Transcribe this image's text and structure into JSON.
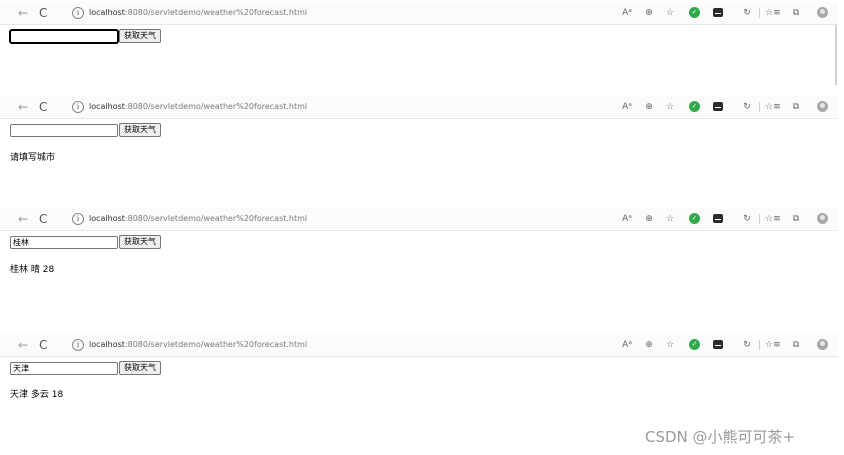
{
  "browser": {
    "url_host": "localhost",
    "url_path": ":8080/servletdemo/weather%20forecast.html",
    "icons": {
      "back": "←",
      "reload": "C",
      "info": "i",
      "read_aloud": "Aᵃ",
      "zoom": "⊕",
      "favorite_add": "☆",
      "extension_1": "✓",
      "refresh_ext": "↻",
      "favorites": "☆≡",
      "collections": "⧉"
    }
  },
  "form": {
    "button_label": "获取天气"
  },
  "panels": [
    {
      "input_value": "",
      "result_text": ""
    },
    {
      "input_value": "",
      "result_text": "请填写城市"
    },
    {
      "input_value": "桂林",
      "result_text": "桂林 晴 28"
    },
    {
      "input_value": "天津",
      "result_text": "天津 多云 18"
    }
  ],
  "watermark": "CSDN @小熊可可茶+"
}
